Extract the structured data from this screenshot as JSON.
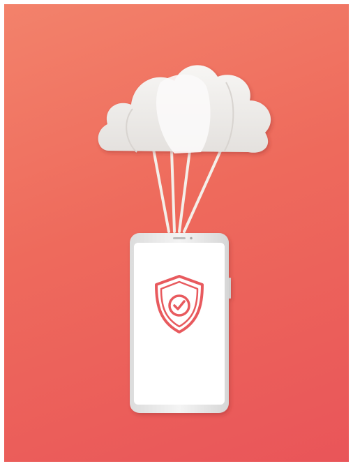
{
  "illustration": {
    "subject": "",
    "colors": {
      "background_top": "#f3826b",
      "background_bottom": "#e95559",
      "cloud": "#f1efed",
      "phone_frame": "#ececec",
      "screen": "#ffffff",
      "shield": "#e85a5e"
    },
    "icons": [
      "cloud-icon",
      "smartphone-icon",
      "shield-check-icon"
    ]
  }
}
